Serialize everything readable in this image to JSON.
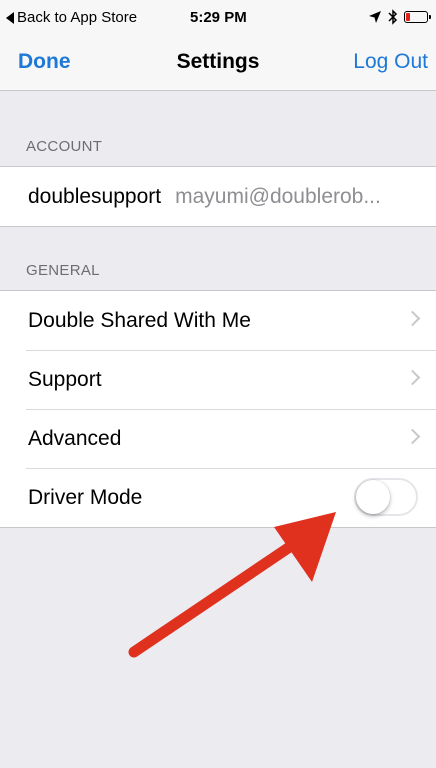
{
  "status_bar": {
    "back_label": "Back to App Store",
    "time": "5:29 PM",
    "icons": [
      "location-icon",
      "bluetooth-icon",
      "battery-icon"
    ],
    "battery_color": "#e0201b"
  },
  "nav": {
    "left_button": "Done",
    "title": "Settings",
    "right_button": "Log Out",
    "accent_color": "#1e78d6"
  },
  "account": {
    "header": "ACCOUNT",
    "username": "doublesupport",
    "email": "mayumi@doublerob..."
  },
  "general": {
    "header": "GENERAL",
    "items": [
      {
        "label": "Double Shared With Me"
      },
      {
        "label": "Support"
      },
      {
        "label": "Advanced"
      }
    ],
    "driver_mode": {
      "label": "Driver Mode",
      "on": false
    }
  },
  "annotation": {
    "color": "#e0301e",
    "icon": "red-arrow-annotation"
  }
}
